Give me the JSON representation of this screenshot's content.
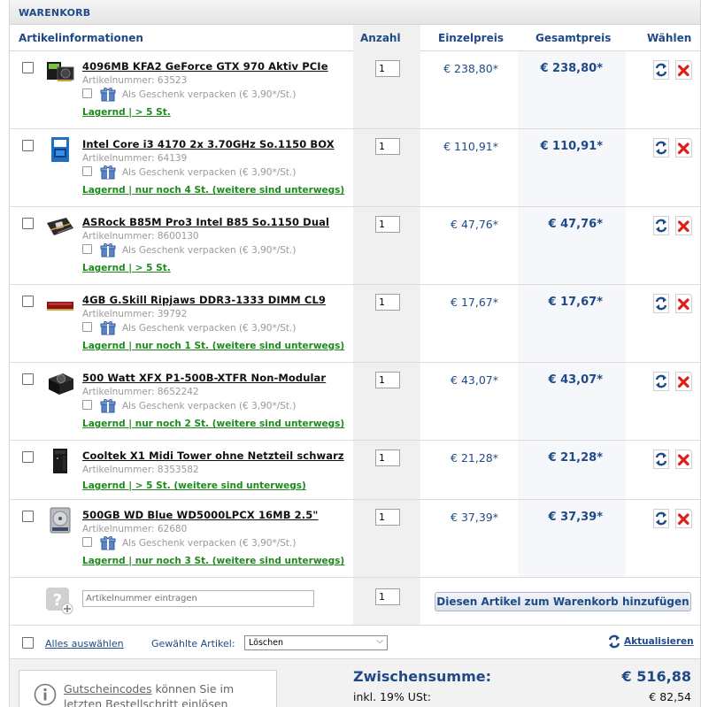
{
  "header": {
    "title": "WARENKORB"
  },
  "columns": {
    "info": "Artikelinformationen",
    "anzahl": "Anzahl",
    "einzelpreis": "Einzelpreis",
    "gesamtpreis": "Gesamtpreis",
    "waehlen": "Wählen"
  },
  "items": [
    {
      "name": "4096MB KFA2 GeForce GTX 970 Aktiv PCIe",
      "artnr": "Artikelnummer: 63523",
      "gift": "Als Geschenk verpacken (€ 3,90*/St.)",
      "stock": "Lagernd | > 5 St.",
      "qty": "1",
      "einzel": "€ 238,80*",
      "gesamt": "€ 238,80*",
      "thumb": "graphics-card"
    },
    {
      "name": "Intel Core i3 4170 2x 3.70GHz So.1150 BOX",
      "artnr": "Artikelnummer: 64139",
      "gift": "Als Geschenk verpacken (€ 3,90*/St.)",
      "stock": "Lagernd | nur noch 4 St. (weitere sind unterwegs)",
      "qty": "1",
      "einzel": "€ 110,91*",
      "gesamt": "€ 110,91*",
      "thumb": "cpu-box"
    },
    {
      "name": "ASRock B85M Pro3 Intel B85 So.1150 Dual",
      "artnr": "Artikelnummer: 8600130",
      "gift": "Als Geschenk verpacken (€ 3,90*/St.)",
      "stock": "Lagernd | > 5 St.",
      "qty": "1",
      "einzel": "€ 47,76*",
      "gesamt": "€ 47,76*",
      "thumb": "mainboard"
    },
    {
      "name": "4GB G.Skill Ripjaws DDR3-1333 DIMM CL9",
      "artnr": "Artikelnummer: 39792",
      "gift": "Als Geschenk verpacken (€ 3,90*/St.)",
      "stock": "Lagernd | nur noch 1 St. (weitere sind unterwegs)",
      "qty": "1",
      "einzel": "€ 17,67*",
      "gesamt": "€ 17,67*",
      "thumb": "ram"
    },
    {
      "name": "500 Watt XFX P1-500B-XTFR Non-Modular",
      "artnr": "Artikelnummer: 8652242",
      "gift": "Als Geschenk verpacken (€ 3,90*/St.)",
      "stock": "Lagernd | nur noch 2 St. (weitere sind unterwegs)",
      "qty": "1",
      "einzel": "€ 43,07*",
      "gesamt": "€ 43,07*",
      "thumb": "psu"
    },
    {
      "name": "Cooltek X1 Midi Tower ohne Netzteil schwarz",
      "artnr": "Artikelnummer: 8353582",
      "gift": "",
      "stock": "Lagernd | > 5 St. (weitere sind unterwegs)",
      "qty": "1",
      "einzel": "€ 21,28*",
      "gesamt": "€ 21,28*",
      "thumb": "tower"
    },
    {
      "name": "500GB WD Blue WD5000LPCX 16MB 2.5\"",
      "artnr": "Artikelnummer: 62680",
      "gift": "Als Geschenk verpacken (€ 3,90*/St.)",
      "stock": "Lagernd | nur noch 3 St. (weitere sind unterwegs)",
      "qty": "1",
      "einzel": "€ 37,39*",
      "gesamt": "€ 37,39*",
      "thumb": "hdd"
    }
  ],
  "add": {
    "placeholder": "Artikelnummer eintragen",
    "qty": "1",
    "button": "Diesen Artikel zum Warenkorb hinzufügen"
  },
  "selection": {
    "select_all": "Alles auswählen",
    "label": "Gewählte Artikel:",
    "option": "Löschen",
    "refresh": "Aktualisieren"
  },
  "footer": {
    "coupon_link": "Gutscheincodes",
    "coupon_text": " können Sie im letzten Bestellschritt einlösen",
    "subtotal_label": "Zwischensumme:",
    "subtotal_value": "€ 516,88",
    "vat_label": "inkl. 19% USt:",
    "vat_value": "€ 82,54"
  },
  "colors": {
    "accent": "#1f4a87",
    "stock": "#1e8a1e",
    "delete": "#e0201a"
  }
}
